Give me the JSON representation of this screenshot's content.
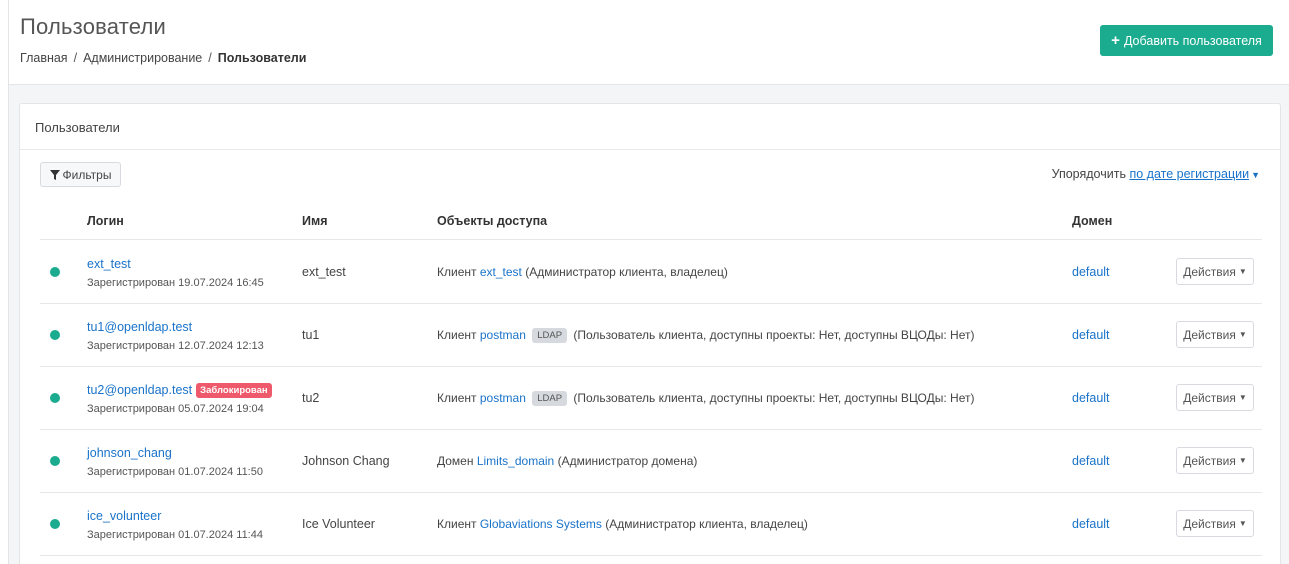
{
  "page": {
    "title": "Пользователи",
    "breadcrumb": [
      "Главная",
      "Администрирование",
      "Пользователи"
    ],
    "add_button_label": "Добавить пользователя"
  },
  "card": {
    "title": "Пользователи",
    "filter_label": "Фильтры",
    "sort_prefix": "Упорядочить",
    "sort_value": "по дате регистрации"
  },
  "table": {
    "columns": [
      "Логин",
      "Имя",
      "Объекты доступа",
      "Домен"
    ],
    "rows": [
      {
        "login": "ext_test",
        "blocked": "",
        "registered": "Зарегистрирован 19.07.2024 16:45",
        "name": "ext_test",
        "access_prefix": "Клиент",
        "access_link": "ext_test",
        "access_badge": "",
        "access_suffix": "(Администратор клиента, владелец)",
        "domain": "default",
        "actions_label": "Действия"
      },
      {
        "login": "tu1@openldap.test",
        "blocked": "",
        "registered": "Зарегистрирован 12.07.2024 12:13",
        "name": "tu1",
        "access_prefix": "Клиент",
        "access_link": "postman",
        "access_badge": "LDAP",
        "access_suffix": "(Пользователь клиента, доступны проекты: Нет, доступны ВЦОДы: Нет)",
        "domain": "default",
        "actions_label": "Действия"
      },
      {
        "login": "tu2@openldap.test",
        "blocked": "Заблокирован",
        "registered": "Зарегистрирован 05.07.2024 19:04",
        "name": "tu2",
        "access_prefix": "Клиент",
        "access_link": "postman",
        "access_badge": "LDAP",
        "access_suffix": "(Пользователь клиента, доступны проекты: Нет, доступны ВЦОДы: Нет)",
        "domain": "default",
        "actions_label": "Действия"
      },
      {
        "login": "johnson_chang",
        "blocked": "",
        "registered": "Зарегистрирован 01.07.2024 11:50",
        "name": "Johnson Chang",
        "access_prefix": "Домен",
        "access_link": "Limits_domain",
        "access_badge": "",
        "access_suffix": "(Администратор домена)",
        "domain": "default",
        "actions_label": "Действия"
      },
      {
        "login": "ice_volunteer",
        "blocked": "",
        "registered": "Зарегистрирован 01.07.2024 11:44",
        "name": "Ice Volunteer",
        "access_prefix": "Клиент",
        "access_link": "Globaviations Systems",
        "access_badge": "",
        "access_suffix": "(Администратор клиента, владелец)",
        "domain": "default",
        "actions_label": "Действия"
      }
    ]
  },
  "colors": {
    "accent": "#1bab8f",
    "link": "#1a73c9",
    "blocked": "#ee5a6b",
    "status_active": "#1bab8f"
  },
  "icons": [
    "plus-icon",
    "filter-icon",
    "caret-down-icon",
    "status-dot-icon"
  ]
}
